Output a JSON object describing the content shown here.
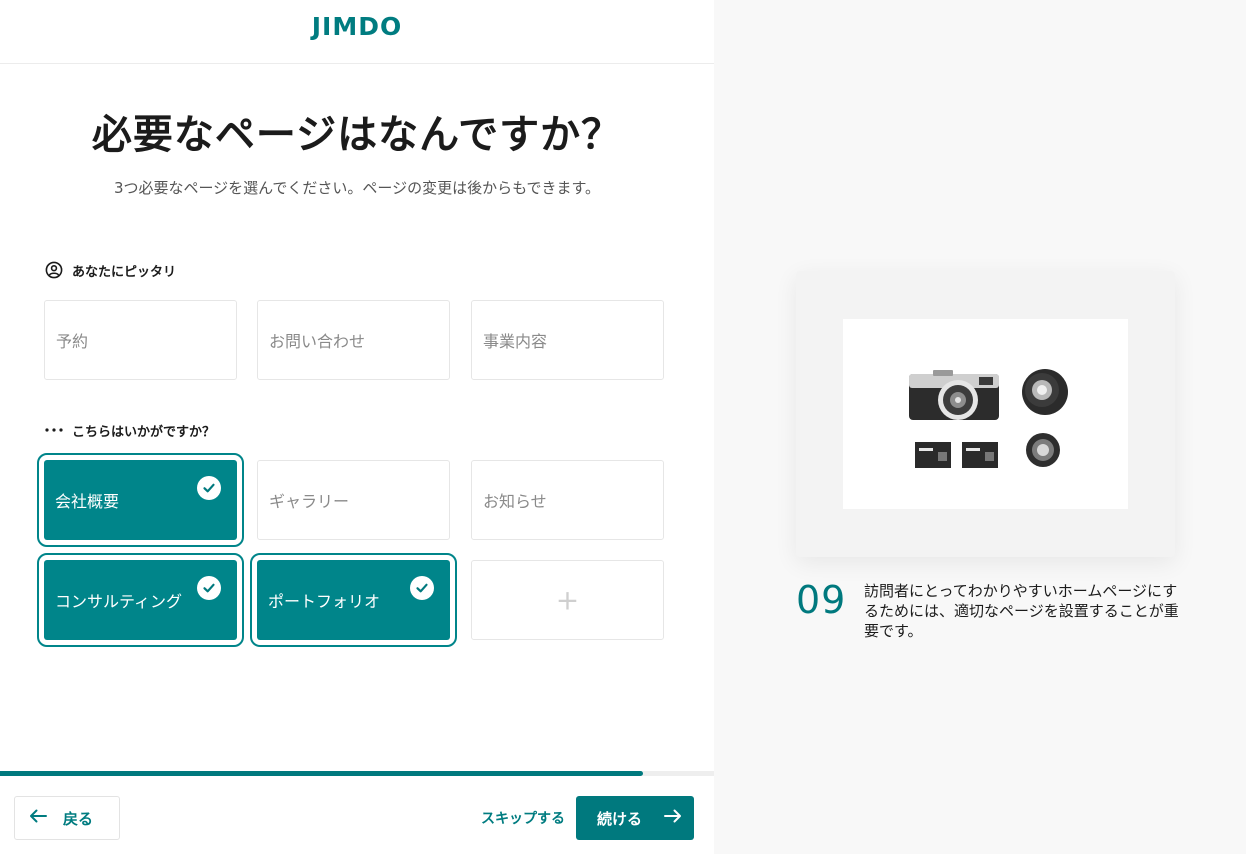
{
  "header": {
    "logo_text": "JIMDO"
  },
  "main": {
    "title": "必要なページはなんですか？",
    "subtitle": "3つ必要なページを選んでください。ページの変更は後からもできます。"
  },
  "section_recommended": {
    "label": "あなたにピッタリ",
    "icon": "user-heart-icon",
    "tiles": [
      {
        "label": "予約",
        "selected": false
      },
      {
        "label": "お問い合わせ",
        "selected": false
      },
      {
        "label": "事業内容",
        "selected": false
      }
    ]
  },
  "section_suggestions": {
    "label": "こちらはいかがですか？",
    "icon": "dots-icon",
    "tiles": [
      {
        "label": "会社概要",
        "selected": true
      },
      {
        "label": "ギャラリー",
        "selected": false
      },
      {
        "label": "お知らせ",
        "selected": false
      },
      {
        "label": "コンサルティング",
        "selected": true
      },
      {
        "label": "ポートフォリオ",
        "selected": true
      }
    ],
    "add_tile_label": "+"
  },
  "progress": {
    "value": 0.9
  },
  "footer": {
    "back_label": "戻る",
    "skip_label": "スキップする",
    "next_label": "続ける"
  },
  "tip": {
    "number": "09",
    "text": "訪問者にとってわかりやすいホームページにするためには、適切なページを設置することが重要です。"
  },
  "colors": {
    "accent": "#00797e",
    "selected_tile": "#00858a",
    "right_panel_bg": "#f8f8f8"
  }
}
